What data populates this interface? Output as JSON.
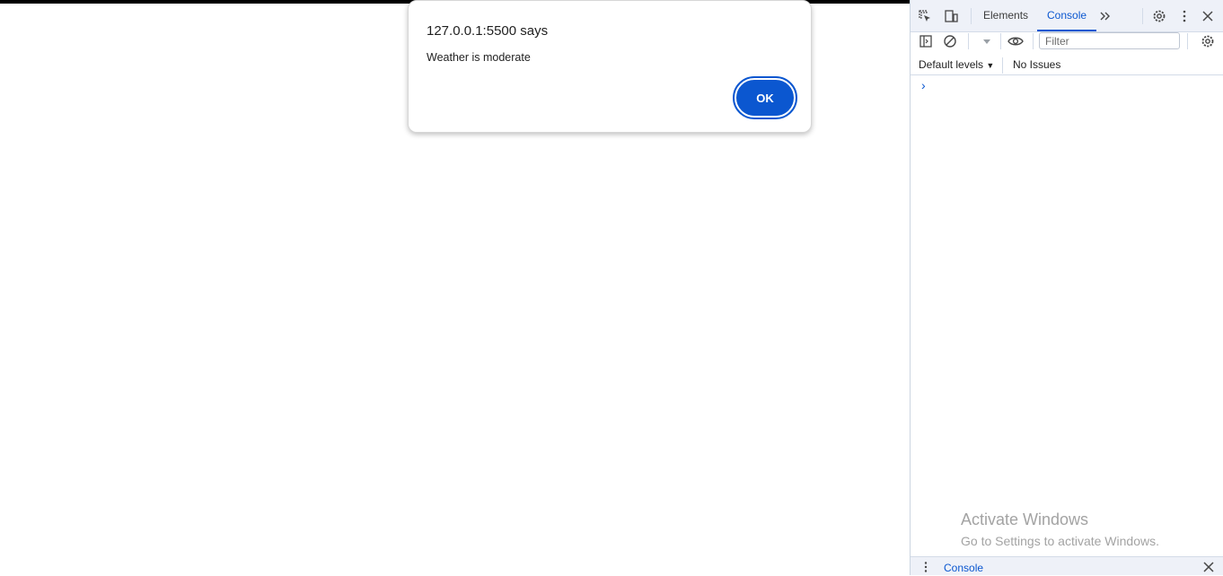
{
  "dialog": {
    "title": "127.0.0.1:5500 says",
    "message": "Weather is moderate",
    "ok_label": "OK"
  },
  "devtools": {
    "tabs": [
      {
        "label": "Elements",
        "active": false
      },
      {
        "label": "Console",
        "active": true
      }
    ],
    "filter_placeholder": "Filter",
    "levels_label": "Default levels",
    "issues_label": "No Issues",
    "drawer_label": "Console",
    "accent_color": "#0b57d0"
  },
  "watermark": {
    "line1": "Activate Windows",
    "line2": "Go to Settings to activate Windows."
  }
}
